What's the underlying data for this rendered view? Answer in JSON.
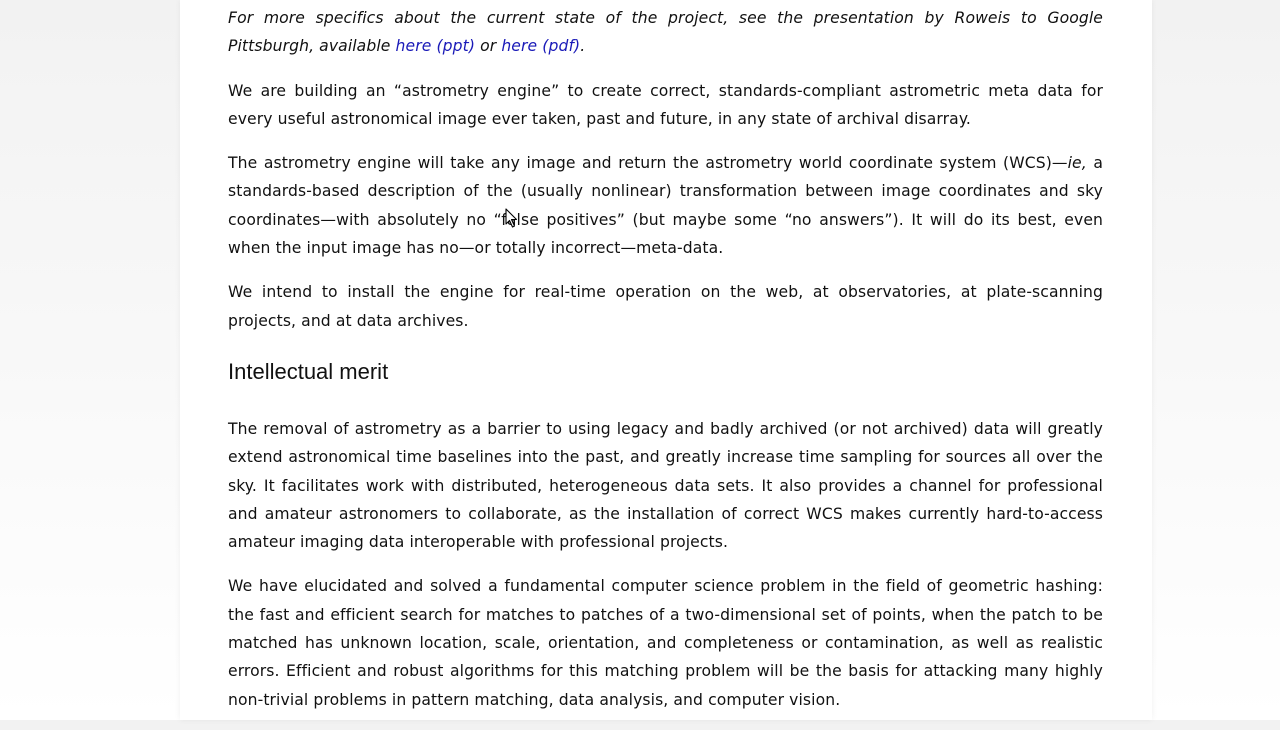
{
  "article": {
    "intro": {
      "prefix": "For more specifics about the current state of the project, see the presentation by Roweis to Google Pittsburgh, available ",
      "link_ppt": "here (ppt)",
      "middle": " or ",
      "link_pdf": "here (pdf)",
      "suffix": "."
    },
    "p1": "We are building an “astrometry engine” to create correct, standards-compliant astrometric meta data for every useful astronomical image ever taken, past and future, in any state of archival disarray.",
    "p2": {
      "before_ie": "The astrometry engine will take any image and return the astrometry world coordinate system (WCS)—",
      "ie": "ie,",
      "after_ie": " a standards-based description of the (usually nonlinear) transformation between image coordinates and sky coordinates—with absolutely no “false positives” (but maybe some “no answers”). It will do its best, even when the input image has no—or totally incorrect—meta-data."
    },
    "p3": "We intend to install the engine for real-time operation on the web, at observatories, at plate-scanning projects, and at data archives.",
    "heading": "Intellectual merit",
    "p4": "The removal of astrometry as a barrier to using legacy and badly archived (or not archived) data will greatly extend astronomical time baselines into the past, and greatly increase time sampling for sources all over the sky. It facilitates work with distributed, heterogeneous data sets. It also provides a channel for professional and amateur astronomers to collaborate, as the installation of correct WCS makes currently hard-to-access amateur imaging data interoperable with professional projects.",
    "p5": "We have elucidated and solved a fundamental computer science problem in the field of geometric hashing: the fast and efficient search for matches to patches of a two-dimensional set of points, when the patch to be matched has unknown location, scale, orientation, and completeness or contamination, as well as realistic errors. Efficient and robust algorithms for this matching problem will be the basis for attacking many highly non-trivial problems in pattern matching, data analysis, and computer vision."
  },
  "colors": {
    "link": "#1a1ab8",
    "text": "#111111",
    "background": "#ffffff"
  },
  "icons": {
    "cursor": "mouse-pointer-icon"
  }
}
